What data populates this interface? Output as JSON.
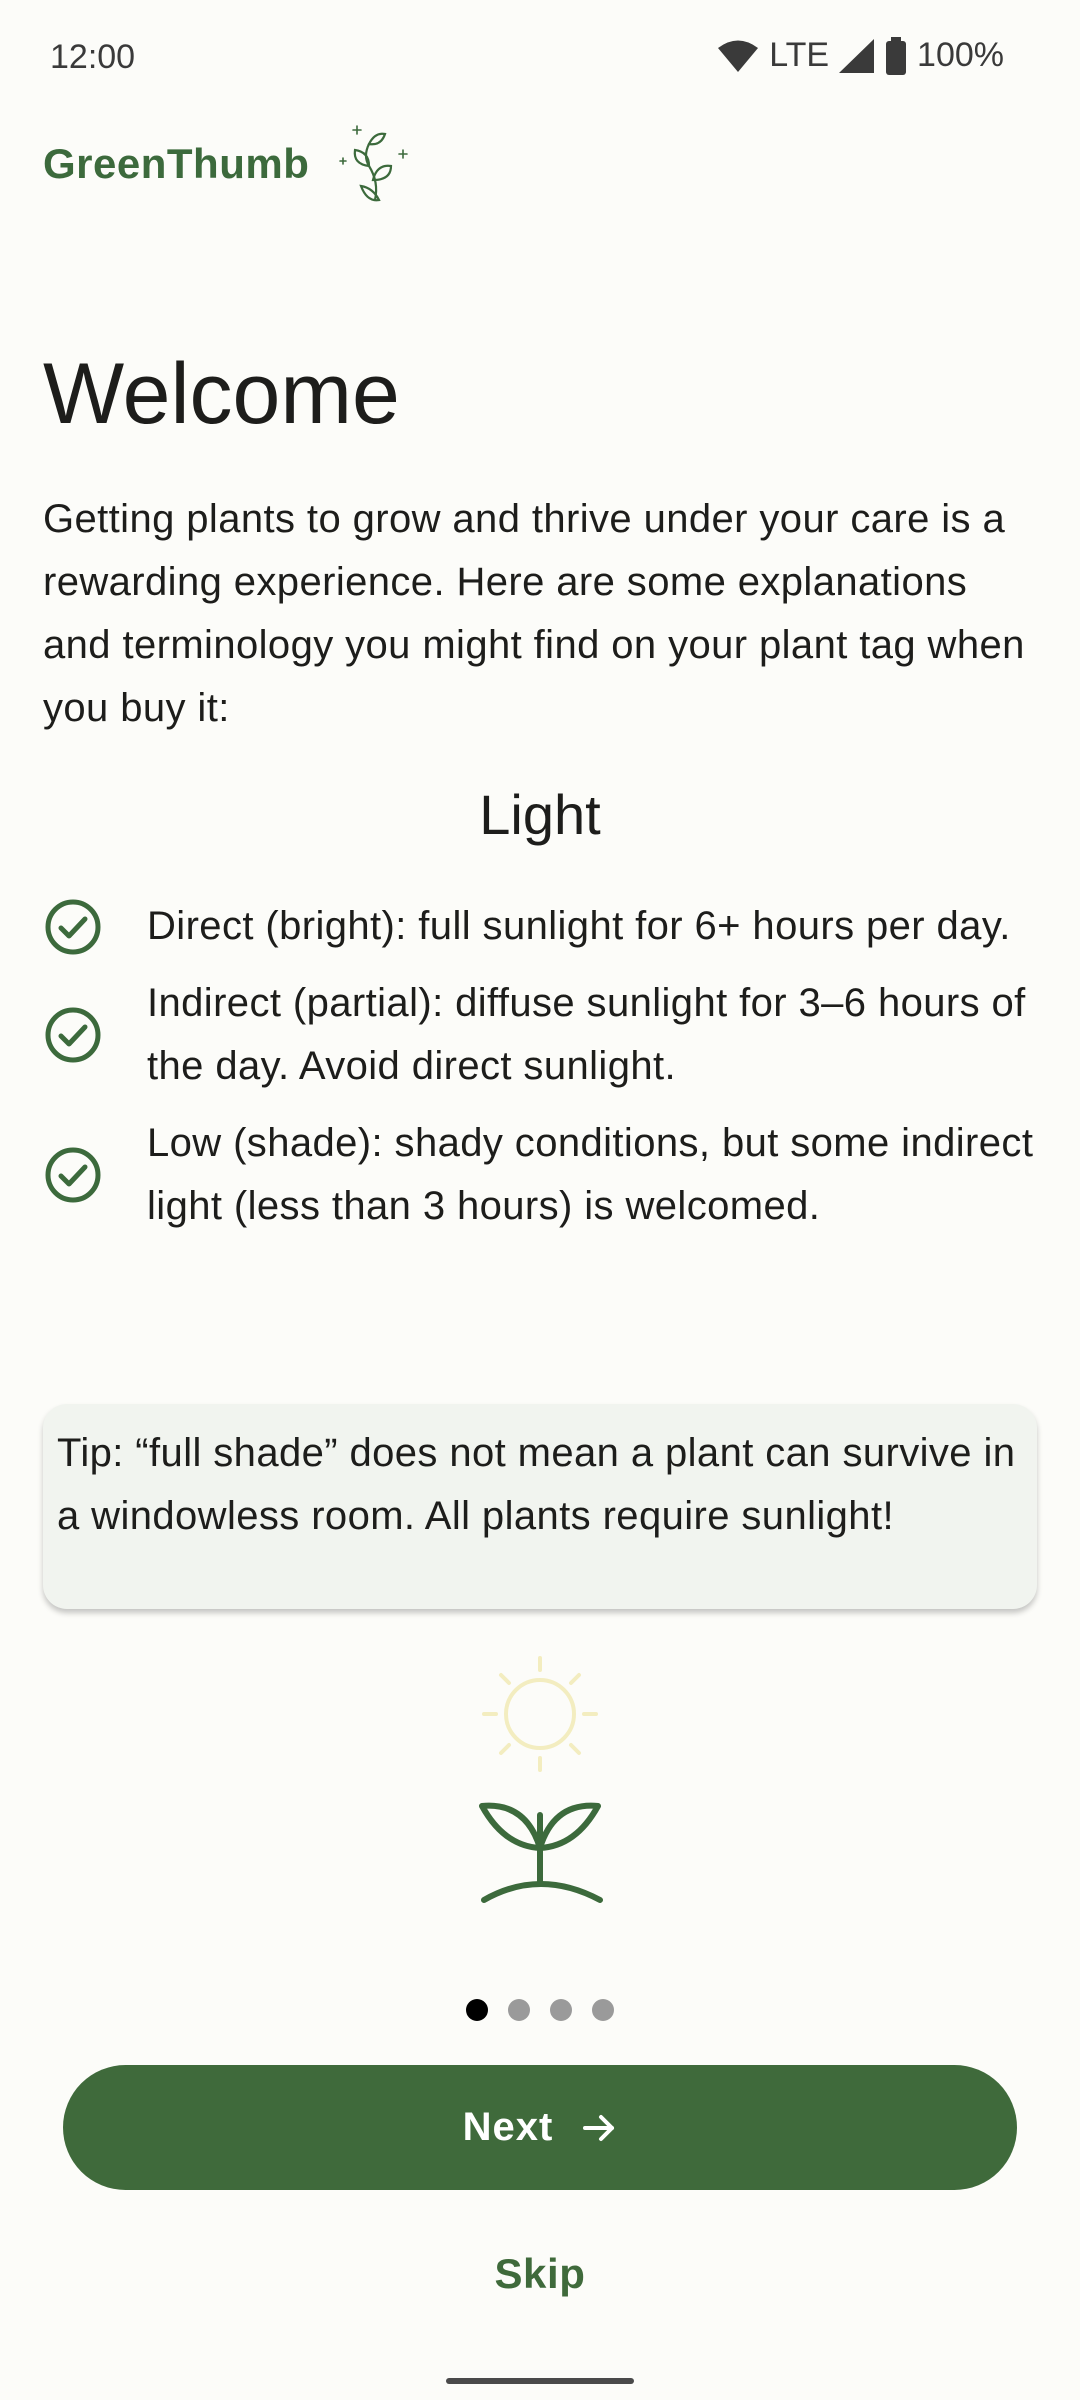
{
  "status_bar": {
    "time": "12:00",
    "network": "LTE",
    "battery": "100%",
    "icons": [
      "wifi-icon",
      "signal-icon",
      "battery-icon"
    ]
  },
  "brand": {
    "name": "GreenThumb",
    "logo_icon": "sprout-sparkle-icon",
    "color": "#3c6a3c"
  },
  "welcome": {
    "title": "Welcome",
    "intro": "Getting plants to grow and thrive under your care is a rewarding experience. Here are some explanations and terminology you might find on your plant tag when you buy it:"
  },
  "light_section": {
    "title": "Light",
    "items": [
      {
        "icon": "check-circle-icon",
        "text": "Direct (bright): full sunlight for 6+ hours per day."
      },
      {
        "icon": "check-circle-icon",
        "text": "Indirect (partial): diffuse sunlight for 3–6 hours of the day. Avoid direct sunlight."
      },
      {
        "icon": "check-circle-icon",
        "text": "Low (shade): shady conditions, but some indirect light (less than 3 hours) is welcomed."
      }
    ]
  },
  "tip": {
    "text": "Tip: “full shade” does not mean a plant can survive in a windowless room. All plants require sunlight!"
  },
  "illustration": {
    "icons": [
      "sun-icon",
      "sprout-icon"
    ],
    "sun_color": "#f3edc0",
    "sprout_color": "#3c6a3c"
  },
  "pager": {
    "total_pages": 4,
    "current_page": 1
  },
  "actions": {
    "next_label": "Next",
    "next_icon": "arrow-right-icon",
    "skip_label": "Skip"
  },
  "colors": {
    "primary": "#3f6a3b",
    "background": "#fcfcf9",
    "tip_background": "#f1f4ef"
  }
}
